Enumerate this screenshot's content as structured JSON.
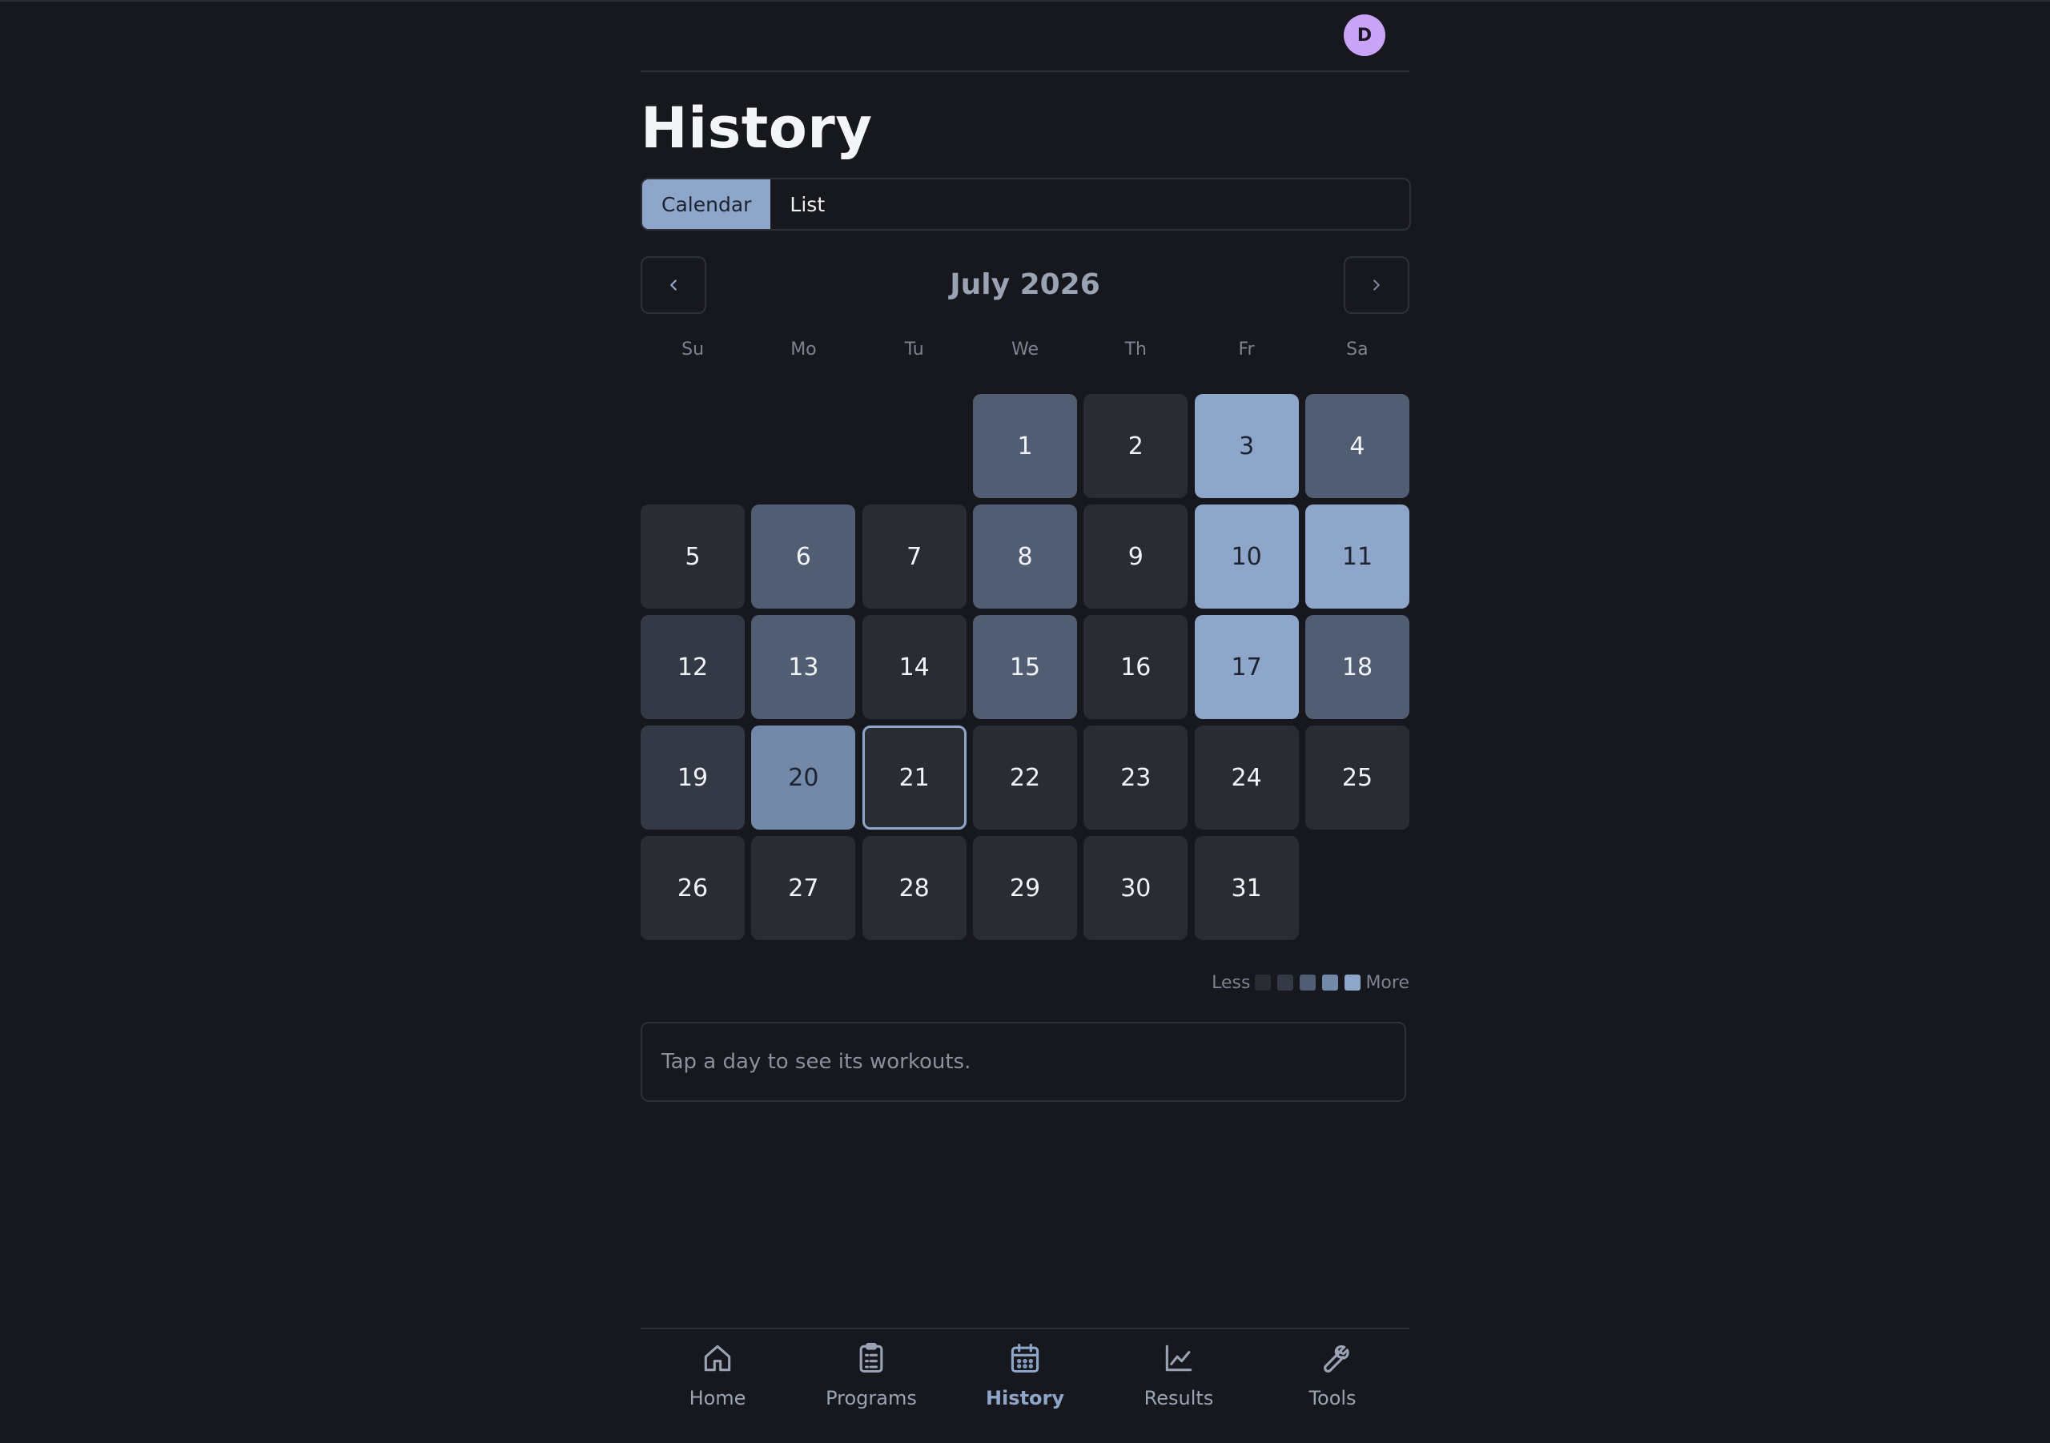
{
  "header": {
    "avatar_initial": "D"
  },
  "page": {
    "title": "History"
  },
  "view_toggle": {
    "calendar_label": "Calendar",
    "list_label": "List",
    "selected": "Calendar"
  },
  "calendar": {
    "month_label": "July 2026",
    "prev_icon": "chevron-left-icon",
    "next_icon": "chevron-right-icon",
    "weekdays": [
      "Su",
      "Mo",
      "Tu",
      "We",
      "Th",
      "Fr",
      "Sa"
    ],
    "first_weekday_index": 3,
    "today": "21",
    "days": [
      {
        "label": "1",
        "level": 2
      },
      {
        "label": "2",
        "level": 0
      },
      {
        "label": "3",
        "level": 4
      },
      {
        "label": "4",
        "level": 2
      },
      {
        "label": "5",
        "level": 0
      },
      {
        "label": "6",
        "level": 2
      },
      {
        "label": "7",
        "level": 0
      },
      {
        "label": "8",
        "level": 2
      },
      {
        "label": "9",
        "level": 0
      },
      {
        "label": "10",
        "level": 4
      },
      {
        "label": "11",
        "level": 4
      },
      {
        "label": "12",
        "level": 1
      },
      {
        "label": "13",
        "level": 2
      },
      {
        "label": "14",
        "level": 0
      },
      {
        "label": "15",
        "level": 2
      },
      {
        "label": "16",
        "level": 0
      },
      {
        "label": "17",
        "level": 4
      },
      {
        "label": "18",
        "level": 2
      },
      {
        "label": "19",
        "level": 1
      },
      {
        "label": "20",
        "level": 3
      },
      {
        "label": "21",
        "level": 0
      },
      {
        "label": "22",
        "level": 0
      },
      {
        "label": "23",
        "level": 0
      },
      {
        "label": "24",
        "level": 0
      },
      {
        "label": "25",
        "level": 0
      },
      {
        "label": "26",
        "level": 0
      },
      {
        "label": "27",
        "level": 0
      },
      {
        "label": "28",
        "level": 0
      },
      {
        "label": "29",
        "level": 0
      },
      {
        "label": "30",
        "level": 0
      },
      {
        "label": "31",
        "level": 0
      }
    ]
  },
  "legend": {
    "less_label": "Less",
    "more_label": "More",
    "colors": [
      "#2a2c34",
      "#343946",
      "#515d72",
      "#7289a9",
      "#8ea6c9"
    ]
  },
  "detail": {
    "hint": "Tap a day to see its workouts."
  },
  "bottom_nav": {
    "active": "History",
    "items": [
      {
        "label": "Home",
        "icon": "home-icon"
      },
      {
        "label": "Programs",
        "icon": "clipboard-icon"
      },
      {
        "label": "History",
        "icon": "calendar-icon"
      },
      {
        "label": "Results",
        "icon": "chart-line-icon"
      },
      {
        "label": "Tools",
        "icon": "wrench-icon"
      }
    ]
  },
  "colors": {
    "background": "#17181d",
    "accent": "#8ea6c9",
    "avatar": "#c9a3f5"
  }
}
